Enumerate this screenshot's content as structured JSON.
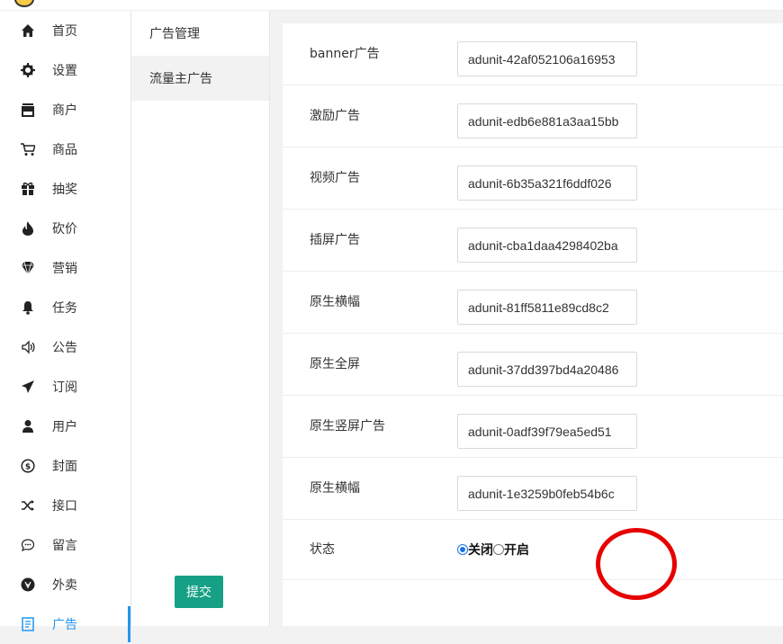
{
  "sidebar": {
    "items": [
      {
        "label": "首页",
        "icon": "home-icon"
      },
      {
        "label": "设置",
        "icon": "gear-icon"
      },
      {
        "label": "商户",
        "icon": "store-icon"
      },
      {
        "label": "商品",
        "icon": "cart-icon"
      },
      {
        "label": "抽奖",
        "icon": "gift-icon"
      },
      {
        "label": "砍价",
        "icon": "fire-icon"
      },
      {
        "label": "营销",
        "icon": "diamond-icon"
      },
      {
        "label": "任务",
        "icon": "bell-icon"
      },
      {
        "label": "公告",
        "icon": "speaker-icon"
      },
      {
        "label": "订阅",
        "icon": "paper-plane-icon"
      },
      {
        "label": "用户",
        "icon": "user-icon"
      },
      {
        "label": "封面",
        "icon": "dollar-icon"
      },
      {
        "label": "接口",
        "icon": "shuffle-icon"
      },
      {
        "label": "留言",
        "icon": "chat-icon"
      },
      {
        "label": "外卖",
        "icon": "takeout-icon"
      },
      {
        "label": "广告",
        "icon": "ad-icon"
      }
    ],
    "accent_color": "#2196f3"
  },
  "subnav": {
    "items": [
      {
        "label": "广告管理"
      },
      {
        "label": "流量主广告"
      }
    ]
  },
  "form": {
    "fields": [
      {
        "label": "banner广告",
        "value": "adunit-42af052106a16953"
      },
      {
        "label": "激励广告",
        "value": "adunit-edb6e881a3aa15bb"
      },
      {
        "label": "视频广告",
        "value": "adunit-6b35a321f6ddf026"
      },
      {
        "label": "插屏广告",
        "value": "adunit-cba1daa4298402ba"
      },
      {
        "label": "原生横幅",
        "value": "adunit-81ff5811e89cd8c2"
      },
      {
        "label": "原生全屏",
        "value": "adunit-37dd397bd4a20486"
      },
      {
        "label": "原生竖屏广告",
        "value": "adunit-0adf39f79ea5ed51"
      },
      {
        "label": "原生横幅",
        "value": "adunit-1e3259b0feb54b6c"
      }
    ],
    "status": {
      "label": "状态",
      "options": [
        "关闭",
        "开启"
      ],
      "selected": "关闭"
    },
    "submit_label": "提交",
    "submit_color": "#16a085",
    "annotation_color": "#e60000"
  }
}
